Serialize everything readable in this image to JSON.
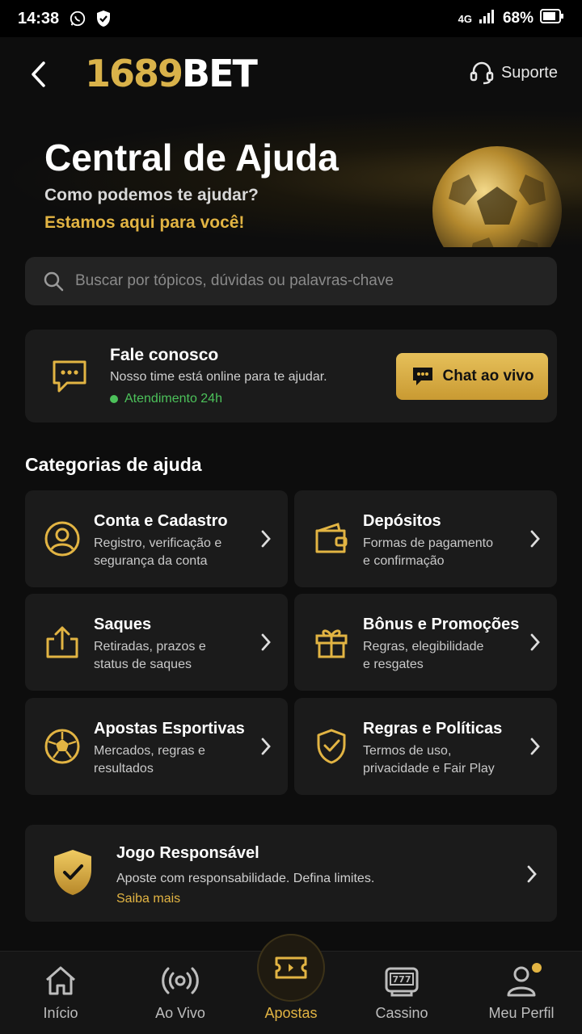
{
  "status_bar": {
    "time": "14:38",
    "network": "4G",
    "battery": "68%"
  },
  "header": {
    "logo_number": "1689",
    "logo_text": "BET",
    "support_label": "Suporte"
  },
  "hero": {
    "title": "Central de Ajuda",
    "subtitle": "Como podemos te ajudar?",
    "tagline": "Estamos aqui para você!"
  },
  "search": {
    "placeholder": "Buscar por tópicos, dúvidas ou palavras-chave"
  },
  "contact": {
    "title": "Fale conosco",
    "description": "Nosso time está online para te ajudar.",
    "status": "Atendimento 24h",
    "button_label": "Chat ao vivo"
  },
  "categories": {
    "title": "Categorias de ajuda",
    "items": [
      {
        "title": "Conta e Cadastro",
        "desc1": "Registro, verificação e",
        "desc2": "segurança da conta",
        "icon": "user-icon"
      },
      {
        "title": "Depósitos",
        "desc1": "Formas de pagamento",
        "desc2": "e confirmação",
        "icon": "wallet-icon"
      },
      {
        "title": "Saques",
        "desc1": "Retiradas, prazos e",
        "desc2": "status de saques",
        "icon": "withdraw-icon"
      },
      {
        "title": "Bônus e Promoções",
        "desc1": "Regras, elegibilidade",
        "desc2": "e resgates",
        "icon": "gift-icon"
      },
      {
        "title": "Apostas Esportivas",
        "desc1": "Mercados, regras e",
        "desc2": "resultados",
        "icon": "soccer-ball-icon"
      },
      {
        "title": "Regras e Políticas",
        "desc1": "Termos de uso,",
        "desc2": "privacidade e Fair Play",
        "icon": "shield-check-icon"
      }
    ]
  },
  "responsible": {
    "title": "Jogo Responsável",
    "description": "Aposte com responsabilidade. Defina limites.",
    "link": "Saiba mais"
  },
  "bottom_nav": {
    "items": [
      {
        "label": "Início",
        "icon": "home-icon"
      },
      {
        "label": "Ao Vivo",
        "icon": "live-icon"
      },
      {
        "label": "Apostas",
        "icon": "ticket-icon",
        "active": true
      },
      {
        "label": "Cassino",
        "icon": "slot-machine-icon"
      },
      {
        "label": "Meu Perfil",
        "icon": "profile-icon"
      }
    ]
  },
  "colors": {
    "accent": "#e2b443",
    "background": "#0d0d0d",
    "card": "#1b1b1b",
    "online": "#4cc15a"
  }
}
